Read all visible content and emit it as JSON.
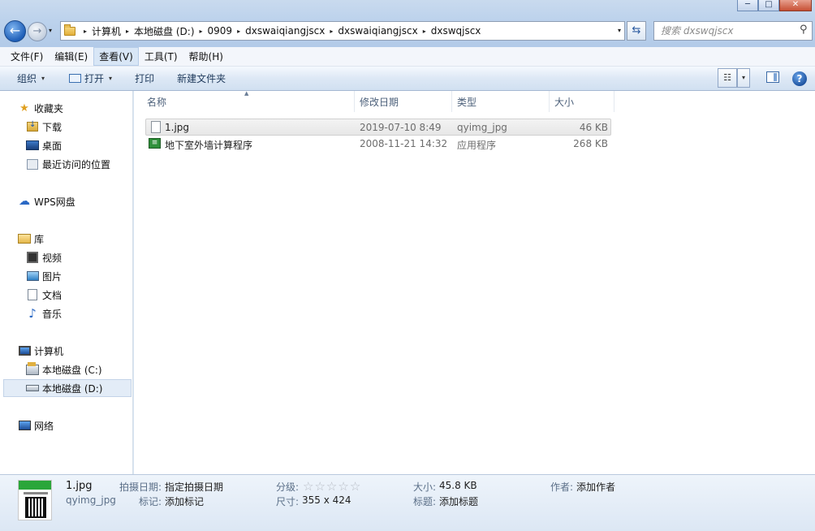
{
  "window": {
    "minimize_glyph": "─",
    "maximize_glyph": "□",
    "close_glyph": "✕"
  },
  "address_bar": {
    "crumbs": [
      "计算机",
      "本地磁盘 (D:)",
      "0909",
      "dxswaiqiangjscx",
      "dxswaiqiangjscx",
      "dxswqjscx"
    ],
    "separator_glyph": "▸",
    "dropdown_glyph": "▾"
  },
  "nav": {
    "back_glyph": "←",
    "forward_glyph": "→",
    "history_glyph": "▾"
  },
  "search": {
    "placeholder": "搜索 dxswqjscx"
  },
  "menu": {
    "items": [
      "文件(F)",
      "编辑(E)",
      "查看(V)",
      "工具(T)",
      "帮助(H)"
    ],
    "active_index": 2
  },
  "toolbar": {
    "organize": "组织",
    "open": "打开",
    "print": "打印",
    "new_folder": "新建文件夹",
    "caret_glyph": "▾",
    "help_glyph": "?"
  },
  "sidebar": {
    "favorites": {
      "label": "收藏夹",
      "items": [
        "下载",
        "桌面",
        "最近访问的位置"
      ]
    },
    "wps": {
      "label": "WPS网盘"
    },
    "libraries": {
      "label": "库",
      "items": [
        "视频",
        "图片",
        "文档",
        "音乐"
      ]
    },
    "computer": {
      "label": "计算机",
      "items": [
        "本地磁盘 (C:)",
        "本地磁盘 (D:)"
      ],
      "selected_index": 1
    },
    "network": {
      "label": "网络"
    }
  },
  "file_list": {
    "columns": [
      "名称",
      "修改日期",
      "类型",
      "大小"
    ],
    "sort_glyph": "▲",
    "rows": [
      {
        "name": "1.jpg",
        "date": "2019-07-10 8:49",
        "type": "qyimg_jpg",
        "size": "46 KB",
        "icon": "image-file-icon"
      },
      {
        "name": "地下室外墙计算程序",
        "date": "2008-11-21 14:32",
        "type": "应用程序",
        "size": "268 KB",
        "icon": "application-icon"
      }
    ]
  },
  "details": {
    "file_name": "1.jpg",
    "file_type": "qyimg_jpg",
    "date_taken_label": "拍摄日期:",
    "date_taken_value": "指定拍摄日期",
    "tags_label": "标记:",
    "tags_value": "添加标记",
    "rating_label": "分级:",
    "rating_stars": 5,
    "rating_value": 0,
    "dimensions_label": "尺寸:",
    "dimensions_value": "355 x 424",
    "size_label": "大小:",
    "size_value": "45.8 KB",
    "title_label": "标题:",
    "title_value": "添加标题",
    "author_label": "作者:",
    "author_value": "添加作者"
  }
}
